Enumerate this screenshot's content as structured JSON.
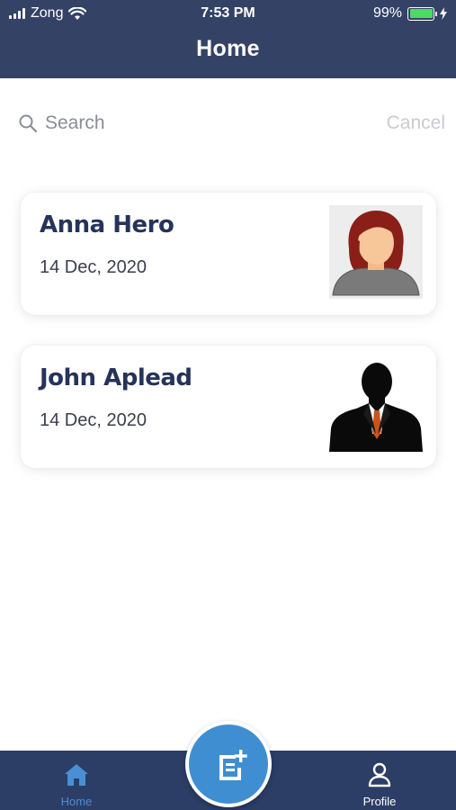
{
  "status_bar": {
    "carrier": "Zong",
    "time": "7:53 PM",
    "battery": "99%"
  },
  "header": {
    "title": "Home"
  },
  "search": {
    "placeholder": "Search",
    "value": "",
    "cancel_label": "Cancel"
  },
  "contacts": [
    {
      "name": "Anna Hero",
      "date": "14 Dec, 2020",
      "avatar": "female-avatar"
    },
    {
      "name": "John Aplead",
      "date": "14 Dec, 2020",
      "avatar": "male-silhouette-avatar"
    }
  ],
  "bottom_nav": {
    "home_label": "Home",
    "profile_label": "Profile",
    "fab_icon": "add-note-icon"
  },
  "colors": {
    "header": "#344266",
    "nav": "#2c3d66",
    "accent": "#3f8ed2",
    "name_text": "#26335a"
  }
}
